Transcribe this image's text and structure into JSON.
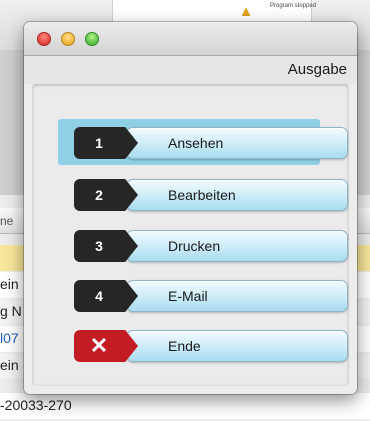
{
  "background": {
    "program_status": "Program stopped",
    "column_header_fragment": "ne",
    "rows": [
      {
        "text": "",
        "style": "sel"
      },
      {
        "text": "ein",
        "style": "white"
      },
      {
        "text": "g N",
        "style": "grey"
      },
      {
        "text": "l07",
        "style": "white blue"
      },
      {
        "text": "ein",
        "style": "grey"
      },
      {
        "text": "-20033-270",
        "style": "white"
      }
    ]
  },
  "window": {
    "title": "Ausgabe",
    "icons": {
      "close": "close-icon",
      "minimize": "minimize-icon",
      "zoom": "zoom-icon",
      "exit": "x-icon"
    }
  },
  "menu": {
    "items": [
      {
        "number": "1",
        "label": "Ansehen",
        "highlighted": true
      },
      {
        "number": "2",
        "label": "Bearbeiten",
        "highlighted": false
      },
      {
        "number": "3",
        "label": "Drucken",
        "highlighted": false
      },
      {
        "number": "4",
        "label": "E-Mail",
        "highlighted": false
      }
    ],
    "exit": {
      "symbol": "✕",
      "label": "Ende"
    }
  },
  "colors": {
    "badge_dark": "#262626",
    "badge_exit": "#c41c23",
    "pill_light": "#d2eef9",
    "highlight": "#8fd0e6",
    "selected_row": "#f8e69a"
  }
}
